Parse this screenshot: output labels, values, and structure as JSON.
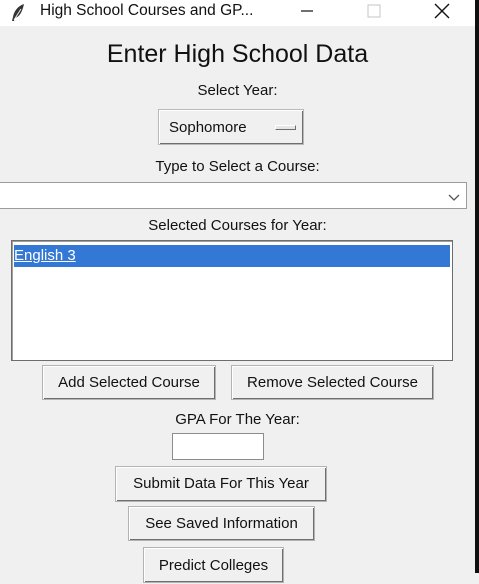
{
  "window": {
    "title": "High School Courses and GP...",
    "controls": [
      "minimize",
      "maximize",
      "close"
    ]
  },
  "heading": "Enter High School Data",
  "year": {
    "label": "Select Year:",
    "selected": "Sophomore"
  },
  "course": {
    "label": "Type to Select a Course:",
    "value": ""
  },
  "selected_courses": {
    "label": "Selected Courses for Year:",
    "items": [
      "English 3"
    ]
  },
  "buttons": {
    "add": "Add Selected Course",
    "remove": "Remove Selected Course",
    "submit": "Submit Data For This Year",
    "saved": "See Saved Information",
    "predict": "Predict Colleges"
  },
  "gpa": {
    "label": "GPA For The Year:",
    "value": ""
  },
  "icons": {
    "app": "feather-icon",
    "minimize": "minimize-icon",
    "maximize": "maximize-icon",
    "close": "close-icon",
    "dropdown": "chevron-down-icon"
  },
  "colors": {
    "selection": "#3478d6",
    "background": "#f0f0f0"
  }
}
